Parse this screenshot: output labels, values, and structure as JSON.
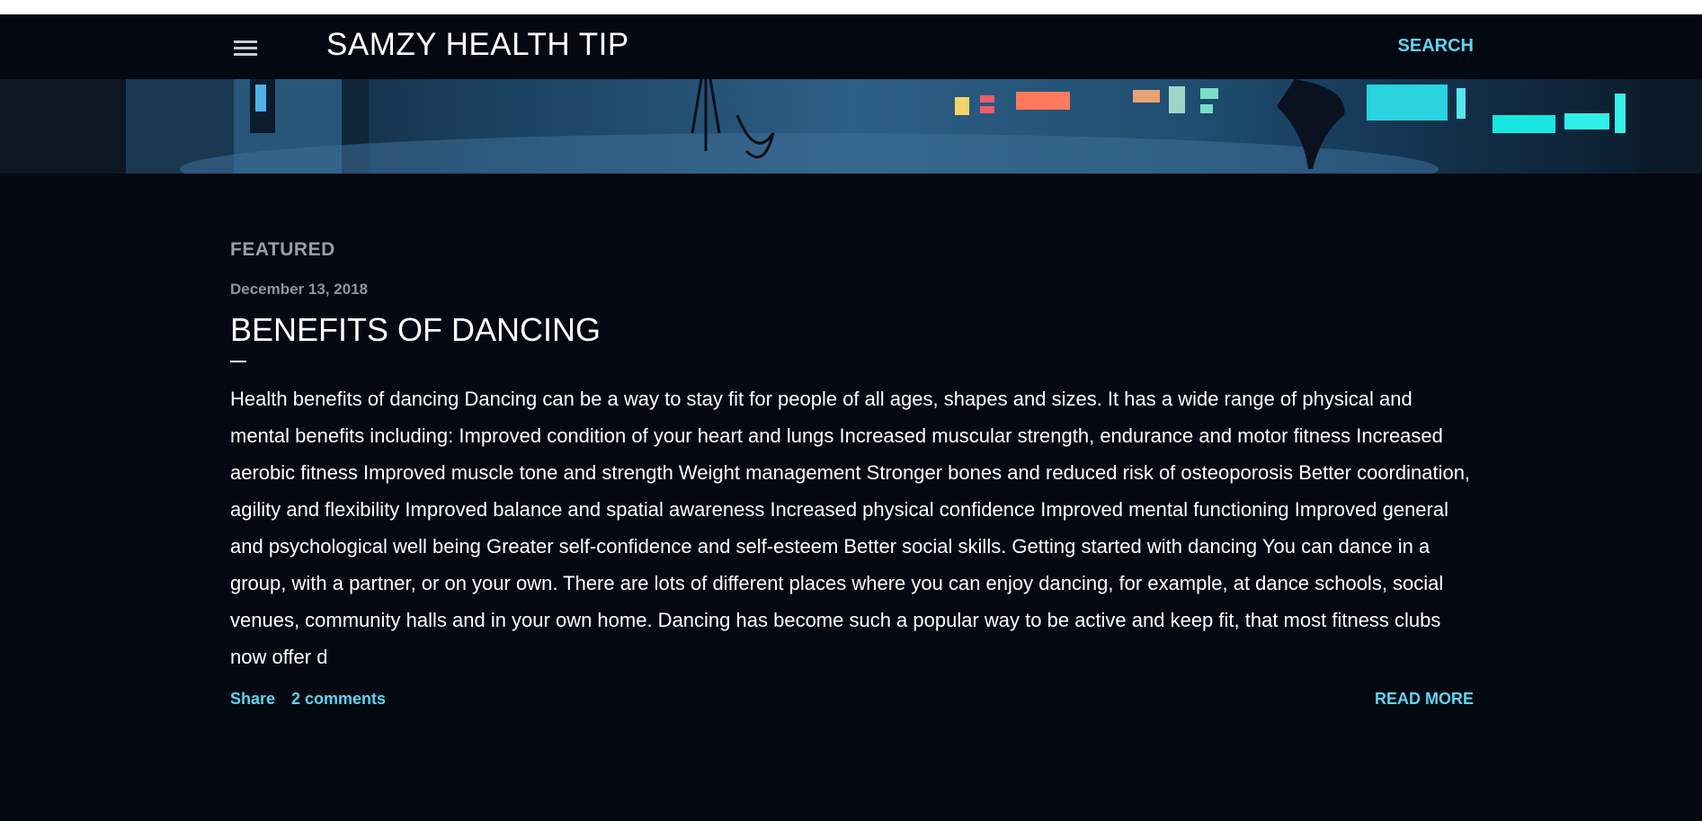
{
  "header": {
    "title": "SAMZY HEALTH TIP",
    "search_label": "SEARCH",
    "menu_icon": "hamburger-menu-icon"
  },
  "post": {
    "featured_label": "FEATURED",
    "date": "December 13, 2018",
    "title": "BENEFITS OF DANCING",
    "snippet": "Health benefits of dancing Dancing can be a way to stay fit for people of all ages, shapes and sizes. It has a wide range of physical and mental benefits including: Improved condition of your heart and lungs Increased muscular strength, endurance and motor fitness Increased aerobic fitness Improved muscle tone and strength Weight management Stronger bones and reduced risk of osteoporosis Better coordination, agility and flexibility Improved balance and spatial awareness Increased physical confidence Improved mental functioning Improved general and psychological well being Greater self-confidence and self-esteem Better social skills. Getting started with dancing You can dance in a group, with a partner, or on your own. There are lots of different places where you can enjoy dancing, for example, at dance schools, social venues, community halls and in your own home. Dancing has become such a popular way to be active and keep fit, that most fitness clubs now offer d",
    "share_label": "Share",
    "comments_label": "2 comments",
    "read_more_label": "READ MORE"
  },
  "colors": {
    "background": "#030811",
    "accent": "#5fd3f3",
    "text": "#ffffff",
    "muted": "#9a9ea5"
  }
}
